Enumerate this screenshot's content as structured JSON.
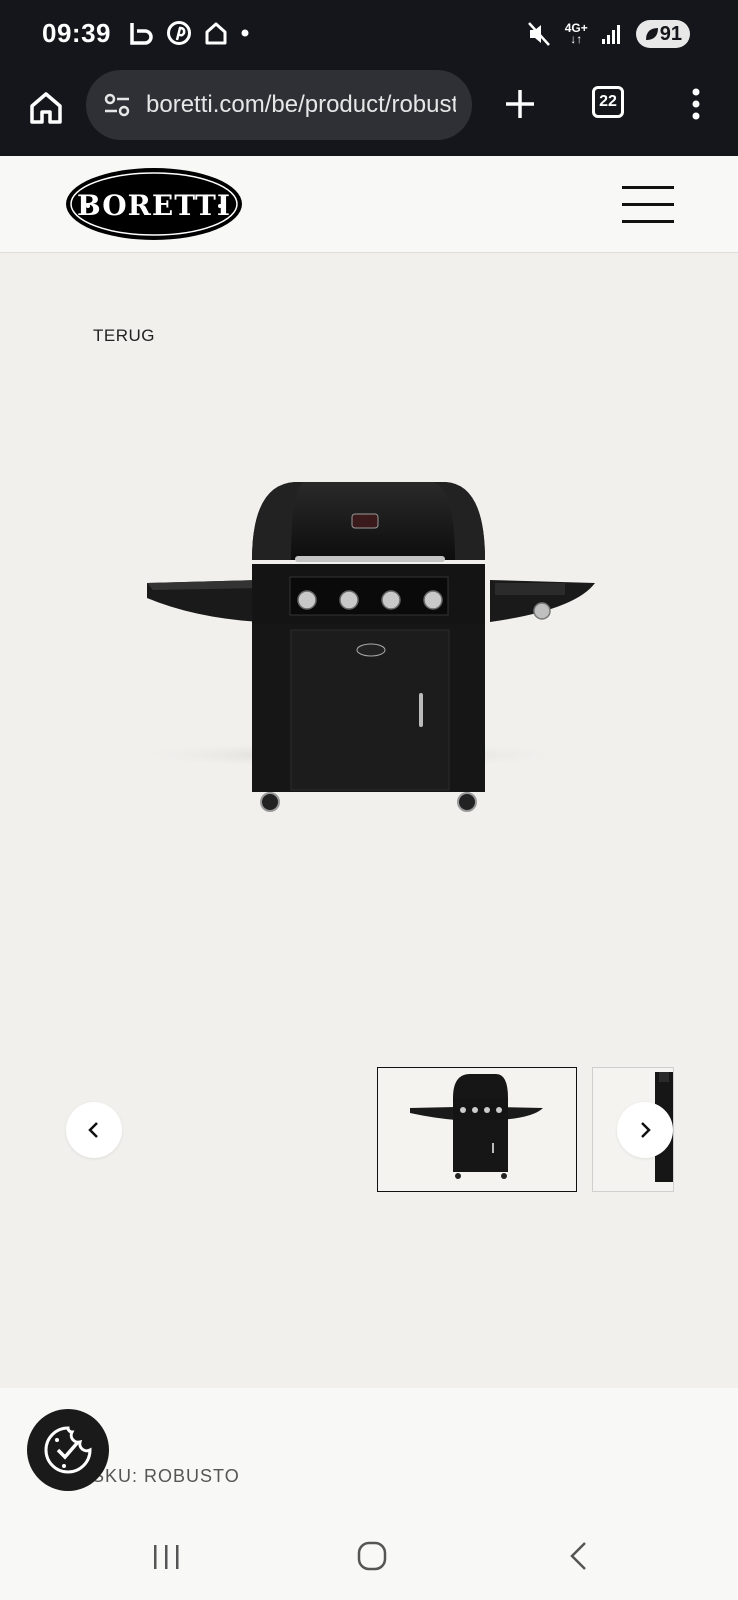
{
  "status_bar": {
    "time": "09:39",
    "network": "4G+",
    "battery": "91",
    "icons": [
      "b-app-icon",
      "pinterest-icon",
      "home-outline-icon",
      "dot-icon",
      "mute-icon",
      "network-icon",
      "signal-icon",
      "battery-icon"
    ]
  },
  "browser": {
    "url": "boretti.com/be/product/robusto",
    "tab_count": "22",
    "icons": [
      "home-icon",
      "site-settings-icon",
      "plus-icon",
      "tabs-icon",
      "more-vert-icon"
    ]
  },
  "header": {
    "logo_text": "BORETTI",
    "menu_icon": "hamburger-icon"
  },
  "main": {
    "back_label": "TERUG",
    "product_image": "robusto-bbq-image",
    "gallery": {
      "prev_icon": "chevron-left-icon",
      "next_icon": "chevron-right-icon",
      "thumbnails": [
        "bbq-front-thumb",
        "bbq-side-thumb"
      ],
      "selected_index": 0
    },
    "sku_label": "SKU: ROBUSTO"
  },
  "cookie_icon": "cookie-check-icon",
  "android_nav": {
    "icons": [
      "recents-icon",
      "home-circle-icon",
      "back-icon"
    ]
  },
  "colors": {
    "status_bg": "#14161b",
    "page_bg": "#f1f0ed",
    "header_bg": "#f8f8f6",
    "accent": "#111111"
  }
}
